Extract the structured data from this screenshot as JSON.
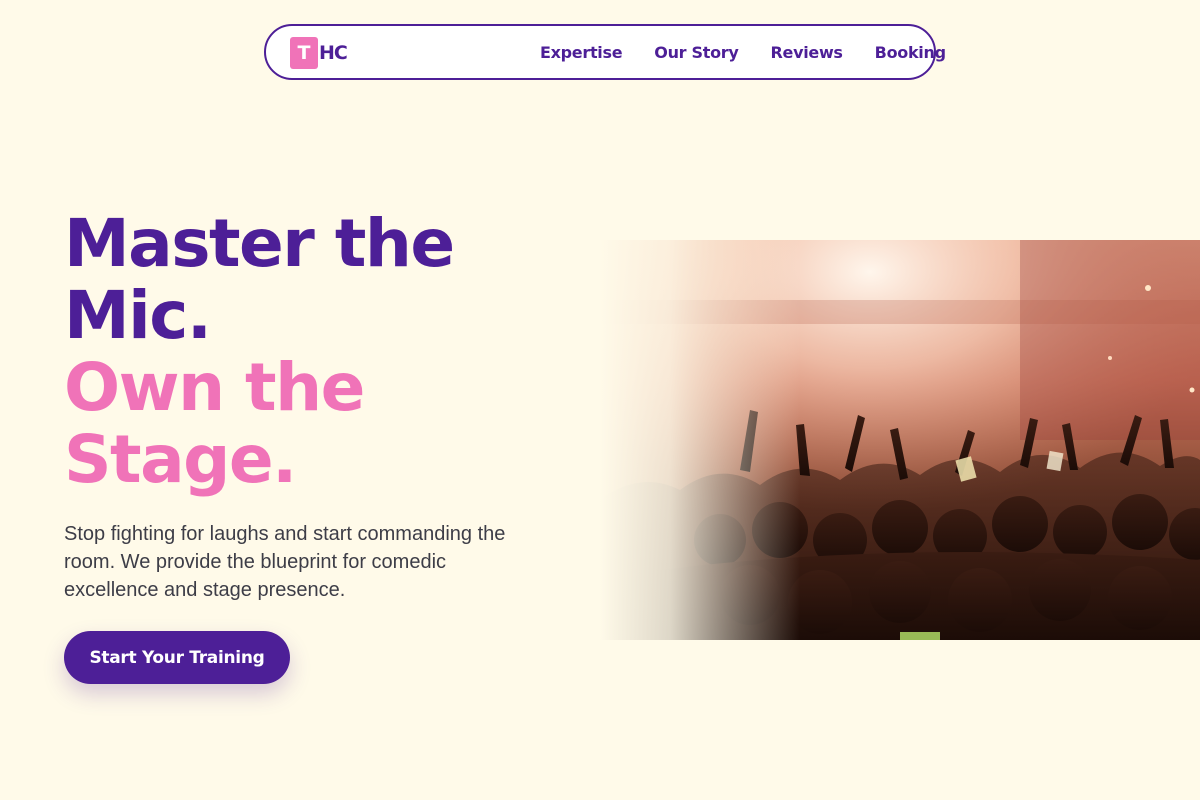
{
  "brand": {
    "logo_letter": "T",
    "logo_rest": "HC",
    "accent": "#4d1f97",
    "pink": "#f073b8",
    "background": "#fffae9"
  },
  "nav": {
    "links": [
      "Expertise",
      "Our Story",
      "Reviews",
      "Booking"
    ]
  },
  "hero": {
    "headline_line1": "Master the",
    "headline_line2": "Mic.",
    "headline_line3": "Own the",
    "headline_line4": "Stage.",
    "subtext": "Stop fighting for laughs and start commanding the room. We provide the blueprint for comedic excellence and stage presence.",
    "cta_label": "Start Your Training",
    "image_icon": "concert-crowd-photo"
  }
}
